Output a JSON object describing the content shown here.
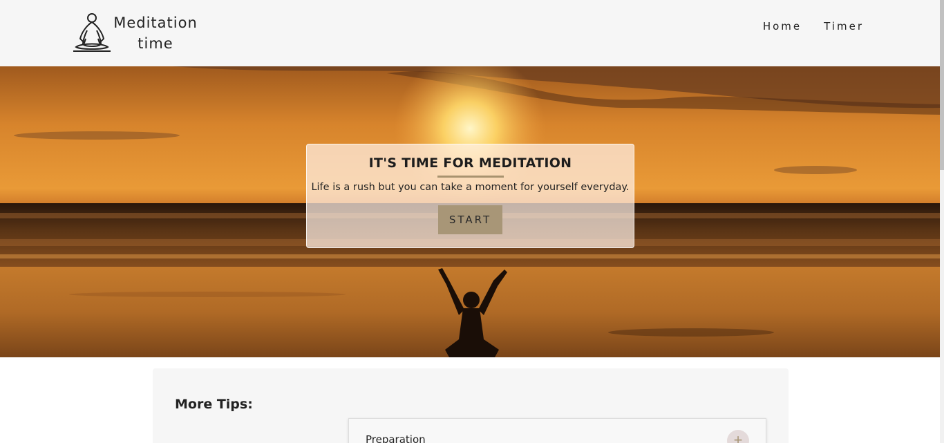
{
  "header": {
    "logo_line1": "Meditation",
    "logo_line2": "time",
    "logo_icon": "meditation-figure-icon",
    "nav": [
      {
        "label": "Home"
      },
      {
        "label": "Timer"
      }
    ]
  },
  "hero": {
    "title": "IT'S TIME FOR MEDITATION",
    "subtitle": "Life is a rush but you can take a moment for yourself everyday.",
    "start_label": "START",
    "accent_color": "#a89677"
  },
  "tips": {
    "title": "More Tips:",
    "items": [
      {
        "label": "Preparation",
        "icon": "plus-icon"
      }
    ]
  }
}
